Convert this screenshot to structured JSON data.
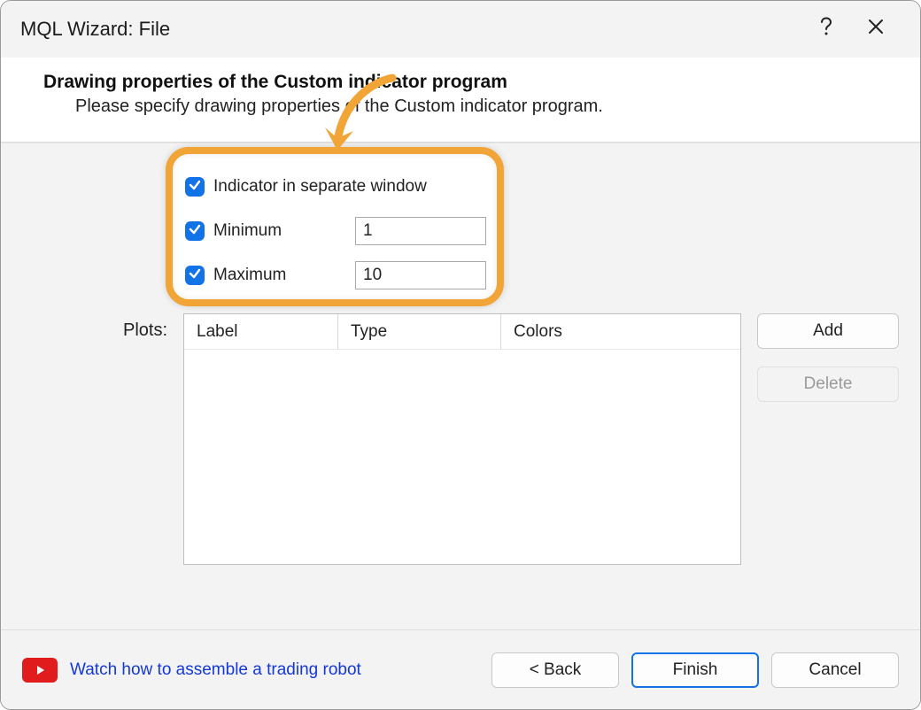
{
  "titlebar": {
    "title": "MQL Wizard: File"
  },
  "header": {
    "title": "Drawing properties of the Custom indicator program",
    "subtitle": "Please specify drawing properties of the Custom indicator program."
  },
  "properties": {
    "separate_window": {
      "checked": true,
      "label": "Indicator in separate window"
    },
    "minimum": {
      "checked": true,
      "label": "Minimum",
      "value": "1"
    },
    "maximum": {
      "checked": true,
      "label": "Maximum",
      "value": "10"
    }
  },
  "plots": {
    "label": "Plots:",
    "columns": {
      "label": "Label",
      "type": "Type",
      "colors": "Colors"
    },
    "rows": []
  },
  "side_buttons": {
    "add": "Add",
    "delete": "Delete"
  },
  "footer": {
    "help_link": "Watch how to assemble a trading robot",
    "back": "< Back",
    "finish": "Finish",
    "cancel": "Cancel"
  }
}
